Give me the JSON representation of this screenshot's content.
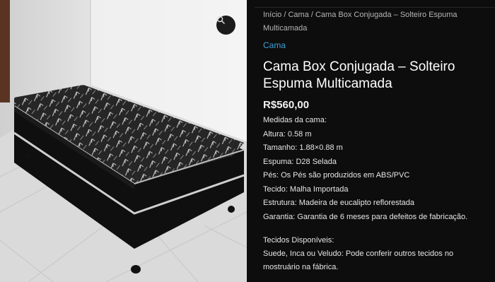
{
  "breadcrumb": {
    "home": "Início",
    "sep1": " / ",
    "category": "Cama",
    "sep2": " / ",
    "current": "Cama Box Conjugada – Solteiro Espuma Multicamada"
  },
  "product": {
    "category_link": "Cama",
    "title": "Cama Box Conjugada – Solteiro Espuma Multicamada",
    "price": "R$560,00",
    "specs": [
      "Medidas da cama:",
      "Altura: 0.58 m",
      "Tamanho: 1.88×0.88 m",
      "Espuma: D28 Selada",
      "Pés: Os Pés são produzidos em ABS/PVC",
      "Tecido: Malha Importada",
      "Estrutura: Madeira de eucalipto reflorestada",
      "Garantia: Garantia de 6 meses para defeitos de fabricação."
    ],
    "fabrics_heading": "Tecidos Disponíveis:",
    "fabrics_text": "Suede, Inca ou Veludo: Pode conferir outros tecidos no mostruário na fábrica."
  },
  "icons": {
    "zoom": "magnifier-icon"
  },
  "colors": {
    "background": "#0d0d0d",
    "link": "#3f9fd8",
    "text": "#e6e6e6"
  }
}
